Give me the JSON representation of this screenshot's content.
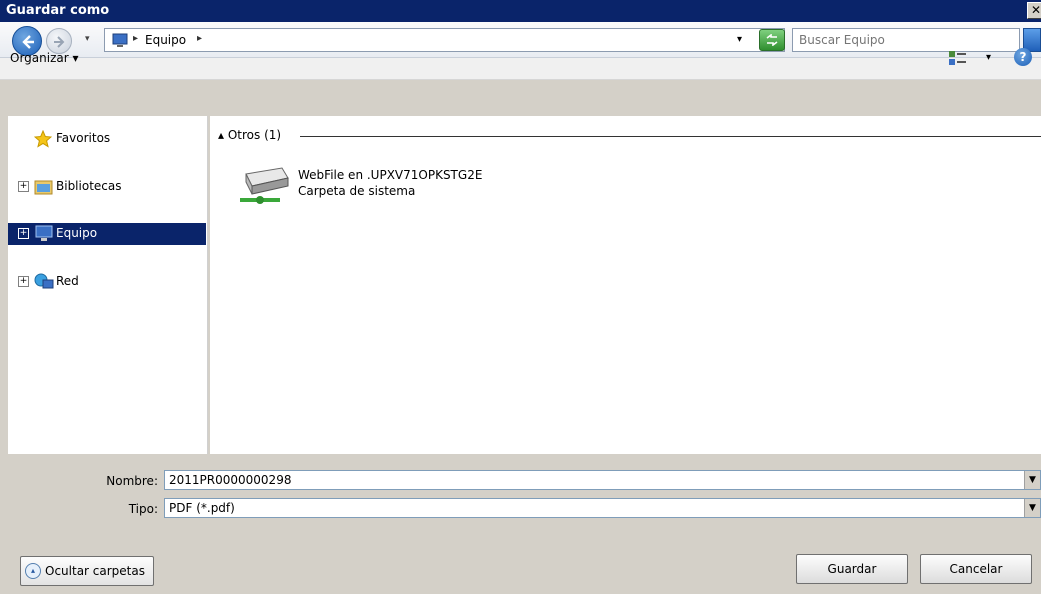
{
  "window": {
    "title": "Guardar como",
    "close_glyph": "✕"
  },
  "address": {
    "location": "Equipo",
    "crumb_arrow": "▸",
    "dropdown_glyph": "▾"
  },
  "search": {
    "placeholder": "Buscar Equipo"
  },
  "toolbar": {
    "organize_label": "Organizar",
    "organize_glyph": "▾",
    "view_glyph": "▾",
    "help_glyph": "?"
  },
  "nav": {
    "items": [
      {
        "label": "Favoritos",
        "icon": "star-icon",
        "expander": ""
      },
      {
        "label": "Bibliotecas",
        "icon": "libraries-icon",
        "expander": "+"
      },
      {
        "label": "Equipo",
        "icon": "computer-icon",
        "expander": "+"
      },
      {
        "label": "Red",
        "icon": "network-icon",
        "expander": "+"
      }
    ]
  },
  "content": {
    "group_header": "Otros (1)",
    "group_glyph": "▴",
    "items": [
      {
        "name": "WebFile en .UPXV71OPKSTG2E",
        "type": "Carpeta de sistema",
        "icon": "network-drive-icon"
      }
    ]
  },
  "form": {
    "filename_label": "Nombre:",
    "filename_value": "2011PR0000000298",
    "filetype_label": "Tipo:",
    "filetype_value": "PDF (*.pdf)",
    "dropdown_glyph": "▼"
  },
  "buttons": {
    "hide_folders": "Ocultar carpetas",
    "hide_glyph": "▴",
    "save": "Guardar",
    "cancel": "Cancelar"
  },
  "colors": {
    "titlebar": "#0a246a",
    "selection": "#0a246a",
    "dialog": "#d4d0c8"
  }
}
